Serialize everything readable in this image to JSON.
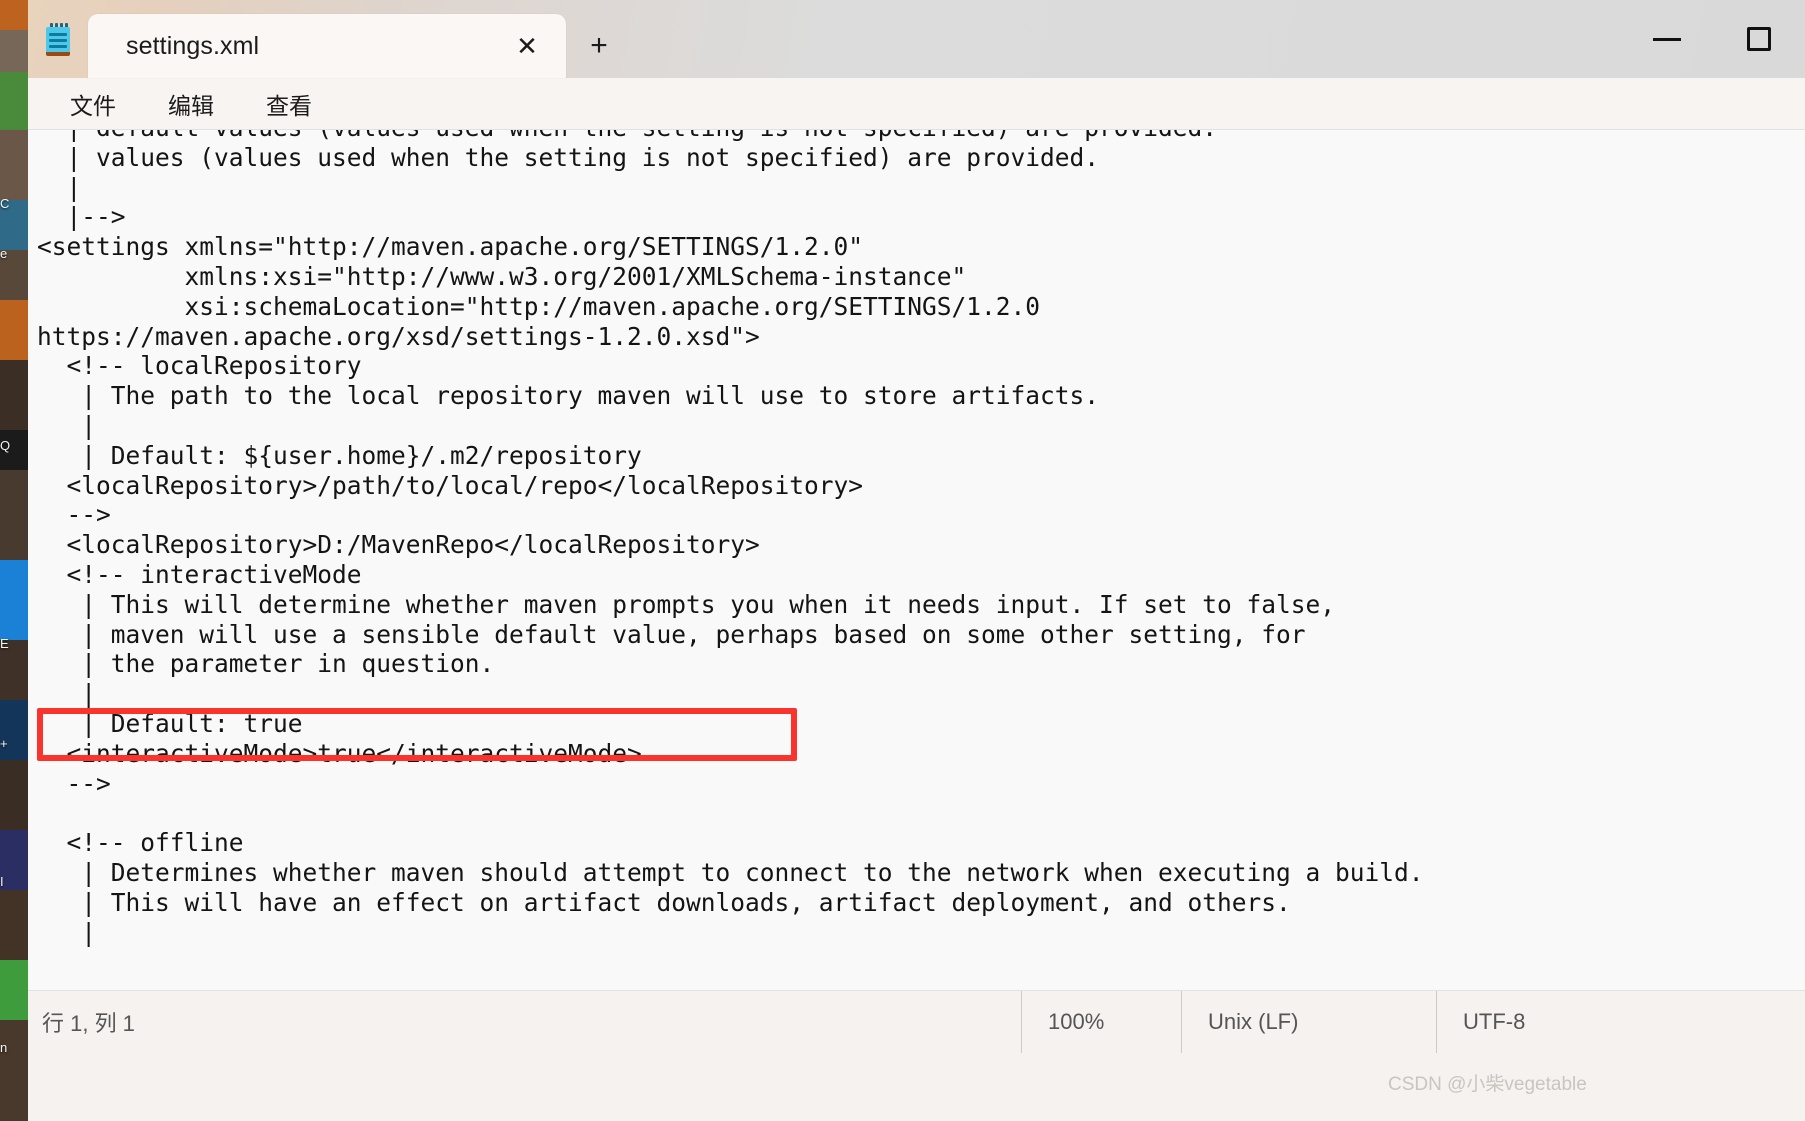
{
  "window": {
    "app_icon": "notepad-icon",
    "controls": {
      "minimize": "minimize-icon",
      "maximize": "maximize-icon"
    }
  },
  "tabs": {
    "active": {
      "label": "settings.xml",
      "close_label": "✕"
    },
    "new_tab_label": "+"
  },
  "menu": {
    "items": [
      {
        "label": "文件"
      },
      {
        "label": "编辑"
      },
      {
        "label": "查看"
      }
    ]
  },
  "editor": {
    "content": "  | default values (values used when the setting is not specified) are provided.\n  | values (values used when the setting is not specified) are provided.\n  |\n  |-->\n<settings xmlns=\"http://maven.apache.org/SETTINGS/1.2.0\"\n          xmlns:xsi=\"http://www.w3.org/2001/XMLSchema-instance\"\n          xsi:schemaLocation=\"http://maven.apache.org/SETTINGS/1.2.0\nhttps://maven.apache.org/xsd/settings-1.2.0.xsd\">\n  <!-- localRepository\n   | The path to the local repository maven will use to store artifacts.\n   |\n   | Default: ${user.home}/.m2/repository\n  <localRepository>/path/to/local/repo</localRepository>\n  -->\n  <localRepository>D:/MavenRepo</localRepository>\n  <!-- interactiveMode\n   | This will determine whether maven prompts you when it needs input. If set to false,\n   | maven will use a sensible default value, perhaps based on some other setting, for\n   | the parameter in question.\n   |\n   | Default: true\n  <interactiveMode>true</interactiveMode>\n  -->\n\n  <!-- offline\n   | Determines whether maven should attempt to connect to the network when executing a build.\n   | This will have an effect on artifact downloads, artifact deployment, and others.\n   |",
    "highlighted_line": "<localRepository>D:/MavenRepo</localRepository>"
  },
  "statusbar": {
    "position": "行 1, 列 1",
    "zoom": "100%",
    "line_ending": "Unix (LF)",
    "encoding": "UTF-8",
    "watermark": "CSDN @小柴vegetable"
  },
  "colors": {
    "highlight": "#f9342c",
    "titlebar_accent": "#e8d3bd",
    "editor_bg": "#f9f9f9"
  },
  "desktop": {
    "icon_labels": [
      "C",
      "e",
      "Q",
      "E",
      "+",
      "I",
      "n"
    ]
  }
}
